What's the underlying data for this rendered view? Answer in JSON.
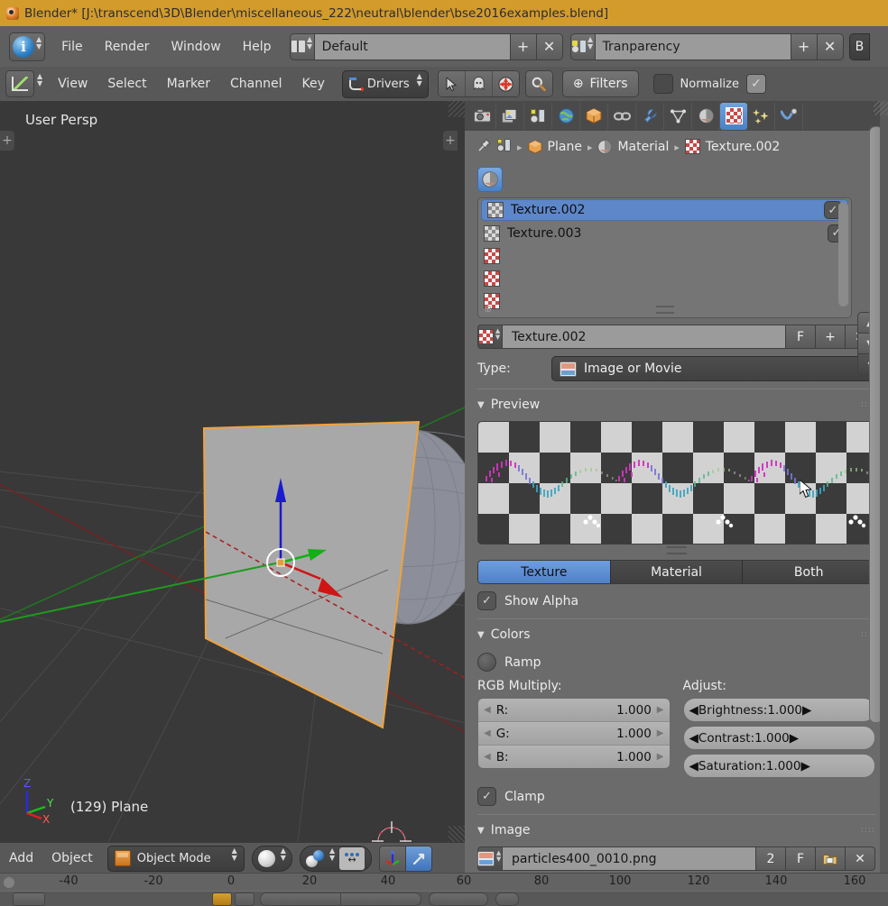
{
  "window": {
    "title": "Blender* [J:\\transcend\\3D\\Blender\\miscellaneous_222\\neutral\\blender\\bse2016examples.blend]",
    "app_icon": "blender-logo-icon"
  },
  "info_header": {
    "editor_type_icon": "info-editor-icon",
    "menus": [
      "File",
      "Render",
      "Window",
      "Help"
    ],
    "screen_layout": {
      "icon": "screen-layout-icon",
      "value": "Default",
      "add_label": "+",
      "remove_label": "✕"
    },
    "scene": {
      "icon": "scene-icon",
      "value": "Tranparency",
      "add_label": "+",
      "remove_label": "✕"
    },
    "engine_partial": "B"
  },
  "drivers_header": {
    "editor_type_icon": "drivers-editor-icon",
    "menus": [
      "View",
      "Select",
      "Marker",
      "Channel",
      "Key"
    ],
    "mode": {
      "icon": "drivers-icon",
      "value": "Drivers"
    },
    "toggles": [
      {
        "name": "cursor-select-icon",
        "active": false
      },
      {
        "name": "ghost-onlyselected-icon",
        "active": true
      },
      {
        "name": "only-errors-icon",
        "active": true
      }
    ],
    "search_icon": "magnifier-icon",
    "filters": {
      "icon": "plus-circle-icon",
      "label": "Filters"
    },
    "normalize": {
      "label": "Normalize",
      "checked": false
    },
    "normalize_auto": {
      "checked": true
    }
  },
  "viewport": {
    "perspective_label": "User Persp",
    "object_label": "(129) Plane",
    "axis_gizmo": {
      "z": "Z",
      "y": "Y",
      "x": "X"
    },
    "background_color": "#393939",
    "selection_outline_color": "#f0a23c",
    "left_plus": "+",
    "right_plus": "+"
  },
  "viewport_header": {
    "menus": [
      "Add",
      "Object"
    ],
    "mode": {
      "icon": "object-cube-icon",
      "value": "Object Mode"
    },
    "viewport_shading_icon": "shading-solid-icon",
    "pivot_icon": "pivot-median-icon",
    "snap_icon": "snap-magnet-icon",
    "manipulator_icon": "manipulator-axis-icon",
    "transform_icon": "transform-translate-icon"
  },
  "timeline_ruler": {
    "ticks": [
      "-40",
      "-20",
      "0",
      "20",
      "40",
      "60",
      "80",
      "100",
      "120",
      "140",
      "160"
    ]
  },
  "properties": {
    "tabs": [
      {
        "name": "render-tab",
        "icon": "camera-icon",
        "selected": false
      },
      {
        "name": "render-layers-tab",
        "icon": "images-icon",
        "selected": false
      },
      {
        "name": "scene-tab",
        "icon": "scene-icon",
        "selected": false
      },
      {
        "name": "world-tab",
        "icon": "world-icon",
        "selected": false
      },
      {
        "name": "object-tab",
        "icon": "cube-icon",
        "selected": false
      },
      {
        "name": "constraints-tab",
        "icon": "chain-icon",
        "selected": false
      },
      {
        "name": "modifiers-tab",
        "icon": "wrench-icon",
        "selected": false
      },
      {
        "name": "data-tab",
        "icon": "triangle-mesh-icon",
        "selected": false
      },
      {
        "name": "material-tab",
        "icon": "material-sphere-icon",
        "selected": false
      },
      {
        "name": "texture-tab",
        "icon": "checker-texture-icon",
        "selected": true
      },
      {
        "name": "particles-tab",
        "icon": "particles-icon",
        "selected": false
      },
      {
        "name": "physics-tab",
        "icon": "physics-icon",
        "selected": false
      }
    ],
    "breadcrumb": [
      {
        "icon": "pin-icon",
        "label": ""
      },
      {
        "icon": "scene-icon",
        "label": ""
      },
      {
        "icon": "cube-icon",
        "label": "Plane"
      },
      {
        "icon": "material-sphere-icon",
        "label": "Material"
      },
      {
        "icon": "checker-texture-icon",
        "label": "Texture.002"
      }
    ],
    "context_button": {
      "icon": "material-sphere-icon",
      "active": true
    },
    "texture_slots": [
      {
        "name": "Texture.002",
        "icon": "checker-gray-icon",
        "selected": true,
        "enabled": true
      },
      {
        "name": "Texture.003",
        "icon": "checker-gray-icon",
        "selected": false,
        "enabled": true
      },
      {
        "name": "",
        "icon": "checker-red-icon",
        "selected": false,
        "enabled": false
      },
      {
        "name": "",
        "icon": "checker-red-icon",
        "selected": false,
        "enabled": false
      },
      {
        "name": "",
        "icon": "checker-red-icon",
        "selected": false,
        "enabled": false
      }
    ],
    "slot_side_buttons": [
      "▲",
      "▼",
      "▾"
    ],
    "datablock": {
      "icon": "checker-red-icon",
      "name": "Texture.002",
      "fake_user": "F",
      "new_label": "+",
      "unlink_label": "✕"
    },
    "type_row": {
      "label": "Type:",
      "icon": "image-icon",
      "value": "Image or Movie"
    },
    "preview_panel": {
      "title": "Preview",
      "buttons": [
        {
          "label": "Texture",
          "active": true
        },
        {
          "label": "Material",
          "active": false
        },
        {
          "label": "Both",
          "active": false
        }
      ],
      "show_alpha": {
        "label": "Show Alpha",
        "checked": true
      }
    },
    "colors_panel": {
      "title": "Colors",
      "ramp": {
        "label": "Ramp",
        "checked": false
      },
      "rgb_multiply_label": "RGB Multiply:",
      "adjust_label": "Adjust:",
      "rgb": [
        {
          "name": "R:",
          "value": "1.000"
        },
        {
          "name": "G:",
          "value": "1.000"
        },
        {
          "name": "B:",
          "value": "1.000"
        }
      ],
      "adjust": [
        {
          "name": "Brightness:",
          "value": "1.000"
        },
        {
          "name": "Contrast:",
          "value": "1.000"
        },
        {
          "name": "Saturation:",
          "value": "1.000"
        }
      ],
      "clamp": {
        "label": "Clamp",
        "checked": true
      }
    },
    "image_panel": {
      "title": "Image",
      "icon": "image-icon",
      "filename": "particles400_0010.png",
      "users": "2",
      "fake_user": "F",
      "open_label": "open-file-icon",
      "unlink_label": "✕"
    }
  },
  "colors": {
    "title_bar": "#d29b2c",
    "header_bg": "#5f5f5f",
    "panel_bg": "#6b6b6b",
    "viewport_bg": "#393939",
    "accent_blue": "#5e87c9",
    "field_bg": "#9b9b9b",
    "number_field": "#b4b4b4"
  }
}
